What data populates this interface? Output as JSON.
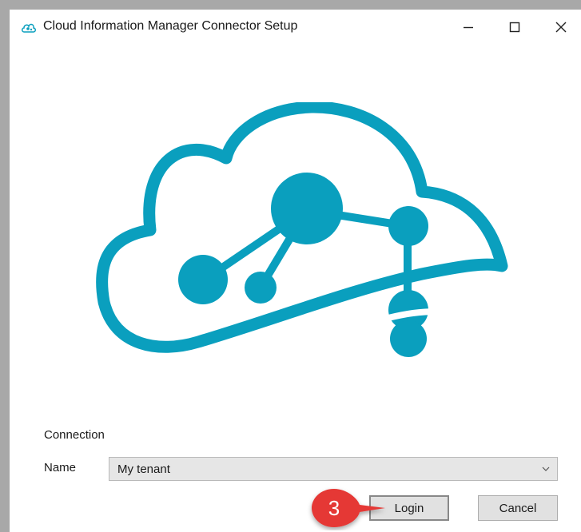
{
  "window": {
    "title": "Cloud Information Manager Connector Setup",
    "controls": {
      "minimize_icon": "minimize-icon",
      "maximize_icon": "maximize-icon",
      "close_icon": "close-icon"
    }
  },
  "logo": {
    "icon": "cloud-network-logo",
    "color": "#0a9fbe"
  },
  "form": {
    "section_label": "Connection",
    "name_label": "Name",
    "name_value": "My tenant"
  },
  "buttons": {
    "login_label": "Login",
    "cancel_label": "Cancel"
  },
  "annotation": {
    "step_number": "3",
    "color": "#e53935"
  }
}
